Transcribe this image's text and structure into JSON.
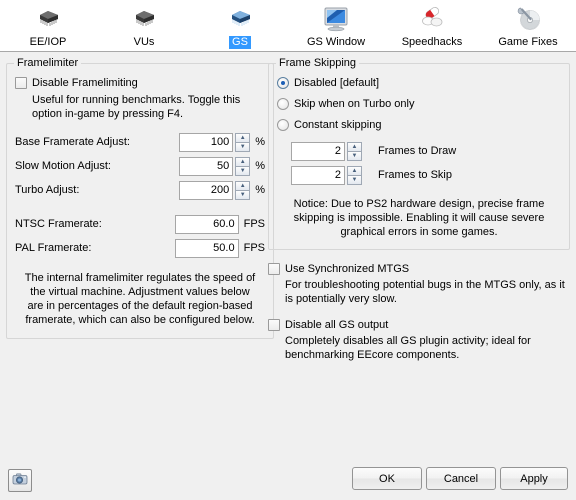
{
  "tabs": [
    {
      "label": "EE/IOP",
      "icon": "cpu-chip-dark-icon",
      "selected": false
    },
    {
      "label": "VUs",
      "icon": "cpu-chip-dark-icon",
      "selected": false
    },
    {
      "label": "GS",
      "icon": "cpu-chip-blue-icon",
      "selected": true
    },
    {
      "label": "GS Window",
      "icon": "monitor-icon",
      "selected": false
    },
    {
      "label": "Speedhacks",
      "icon": "pills-icon",
      "selected": false
    },
    {
      "label": "Game Fixes",
      "icon": "disc-wrench-icon",
      "selected": false
    }
  ],
  "framelimiter": {
    "title": "Framelimiter",
    "disable_checkbox": {
      "label": "Disable Framelimiting",
      "checked": false,
      "help": "Useful for running benchmarks. Toggle this option in-game by pressing F4."
    },
    "fields": [
      {
        "label": "Base Framerate Adjust:",
        "value": "100",
        "unit": "%",
        "spinner": true
      },
      {
        "label": "Slow Motion Adjust:",
        "value": "50",
        "unit": "%",
        "spinner": true
      },
      {
        "label": "Turbo Adjust:",
        "value": "200",
        "unit": "%",
        "spinner": true
      },
      {
        "label": "NTSC Framerate:",
        "value": "60.0",
        "unit": "FPS",
        "spinner": false
      },
      {
        "label": "PAL Framerate:",
        "value": "50.0",
        "unit": "FPS",
        "spinner": false
      }
    ],
    "notice": "The internal framelimiter regulates the speed of the virtual machine. Adjustment values below are in percentages of the default region-based framerate, which can also be configured below."
  },
  "frame_skipping": {
    "title": "Frame Skipping",
    "options": [
      {
        "label": "Disabled [default]",
        "selected": true
      },
      {
        "label": "Skip when on Turbo only",
        "selected": false
      },
      {
        "label": "Constant skipping",
        "selected": false
      }
    ],
    "counters": [
      {
        "label": "Frames to Draw",
        "value": "2"
      },
      {
        "label": "Frames to Skip",
        "value": "2"
      }
    ],
    "notice": "Notice: Due to PS2 hardware design, precise frame skipping is impossible. Enabling it will cause severe graphical errors in some games."
  },
  "options": [
    {
      "label": "Use Synchronized MTGS",
      "checked": false,
      "help": "For troubleshooting potential bugs in the MTGS only, as it is potentially very slow."
    },
    {
      "label": "Disable all GS output",
      "checked": false,
      "help": "Completely disables all GS plugin activity; ideal for benchmarking EEcore components."
    }
  ],
  "bottom": {
    "camera_icon": "camera-icon",
    "ok_label": "OK",
    "cancel_label": "Cancel",
    "apply_label": "Apply"
  },
  "spinner": {
    "up": "▲",
    "down": "▼"
  },
  "colors": {
    "selection_blue": "#3399ff",
    "radio_dot": "#1d5fb6",
    "window_bg": "#f0f0f0",
    "tabbar_bg": "#ffffff"
  }
}
